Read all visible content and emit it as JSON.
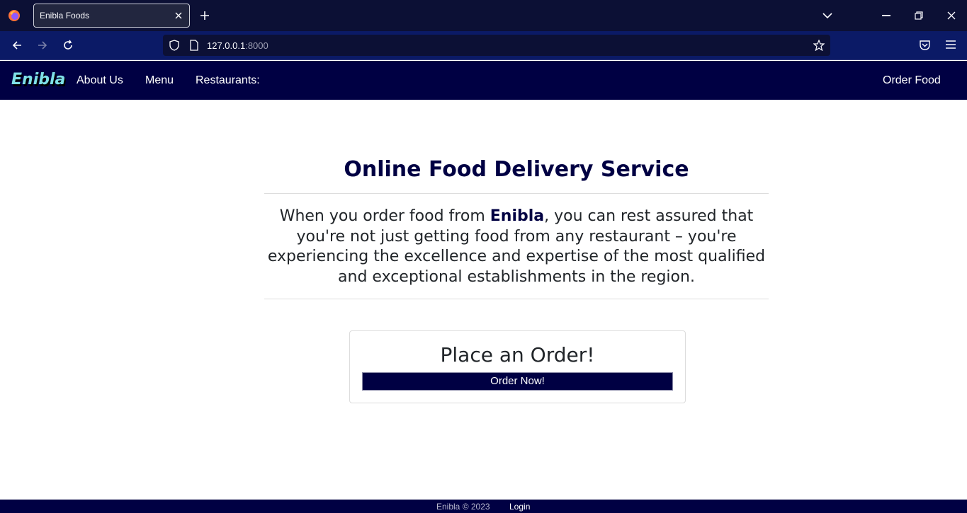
{
  "browser": {
    "tab_title": "Enibla Foods",
    "url_host": "127.0.0.1",
    "url_port": ":8000"
  },
  "site": {
    "brand": "Enibla",
    "nav": [
      "About Us",
      "Menu",
      "Restaurants:"
    ],
    "order_food": "Order Food"
  },
  "hero": {
    "title": "Online Food Delivery Service",
    "lead_before": "When you order food from ",
    "lead_brand": "Enibla",
    "lead_after": ", you can rest assured that you're not just getting food from any restaurant – you're experiencing the excellence and expertise of the most qualified and exceptional establishments in the region."
  },
  "card": {
    "title": "Place an Order!",
    "button": "Order Now!"
  },
  "footer": {
    "copyright": "Enibla © 2023",
    "login": "Login"
  },
  "colors": {
    "navy": "#000043",
    "brand_teal": "#7ee0e6",
    "chrome_dark": "#0c1035",
    "chrome_blue": "#0b1a66"
  }
}
